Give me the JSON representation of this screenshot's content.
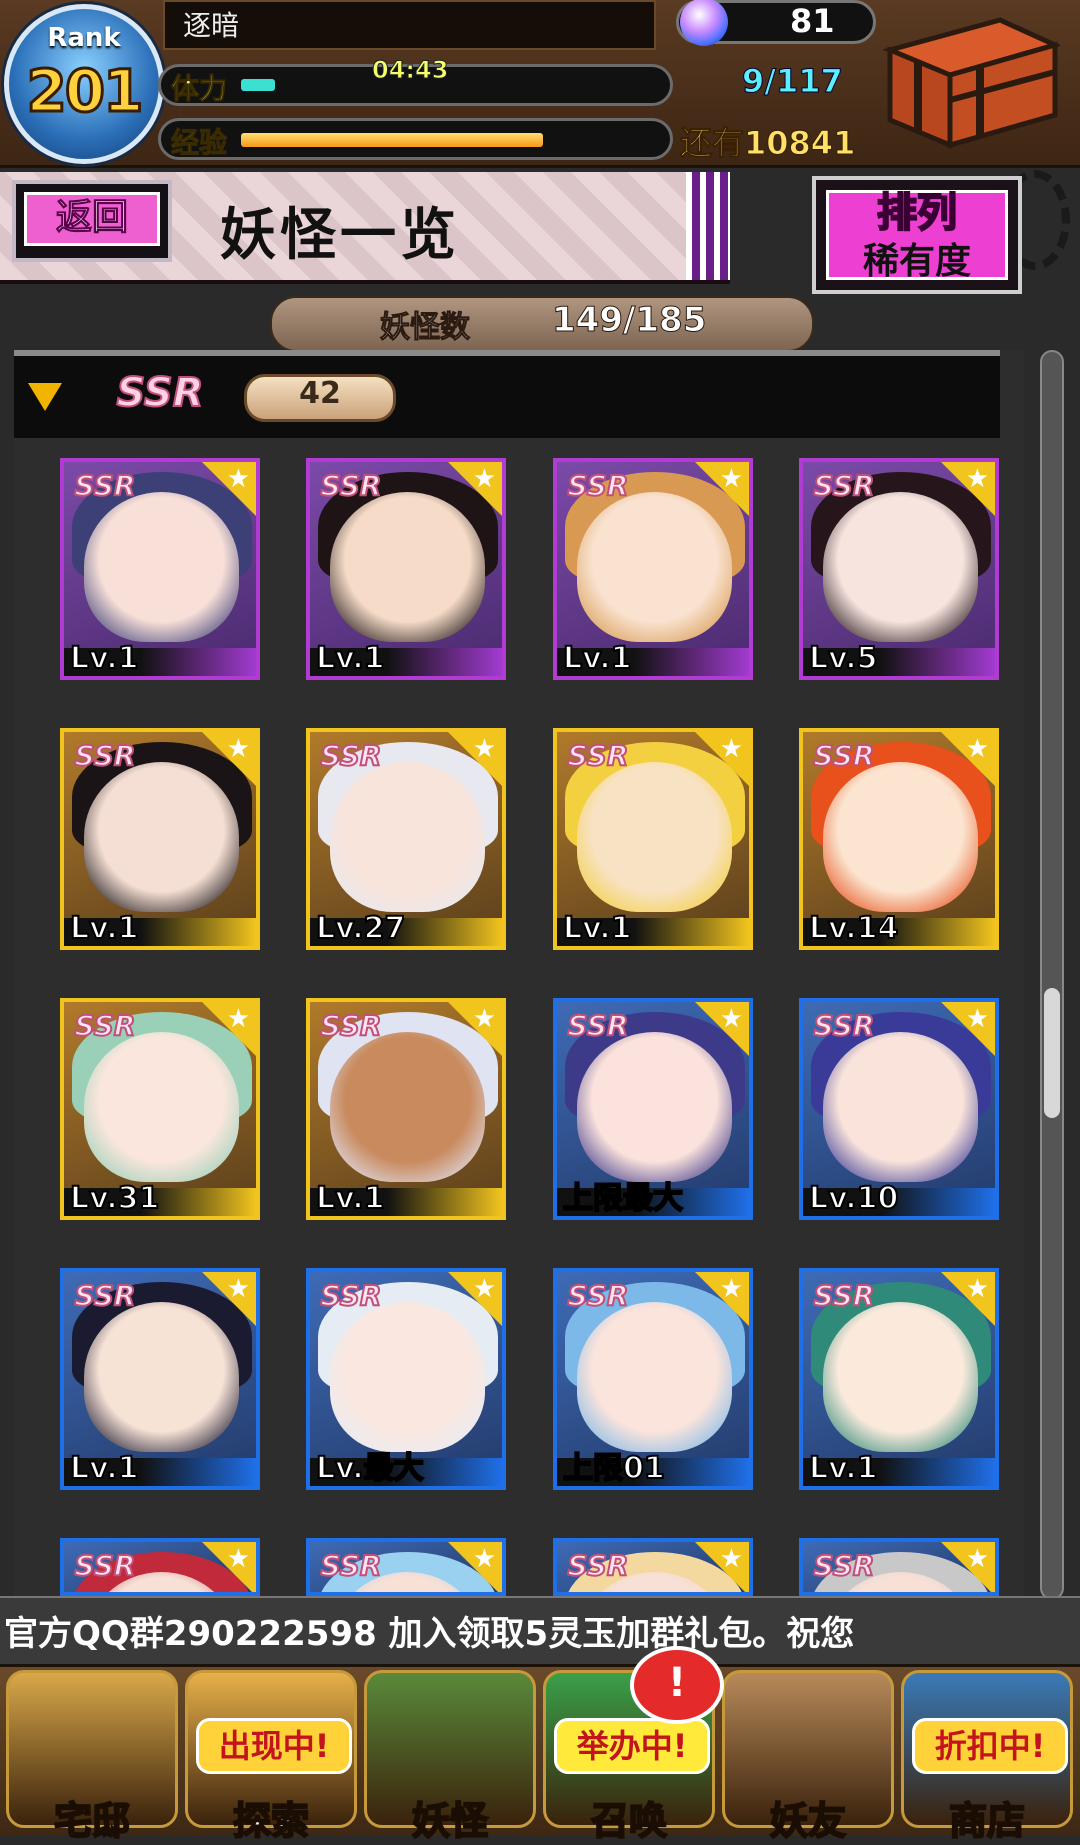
{
  "status": {
    "rank_label": "Rank",
    "rank_value": "201",
    "player_name": "逐暗",
    "stamina_label": "体力",
    "stamina_timer": "04:43",
    "stamina_fraction": 0.08,
    "exp_label": "经验",
    "exp_fraction": 0.72,
    "gem_count": "81",
    "slots": "9/117",
    "exp_remaining": "还有10841",
    "colors": {
      "stamina": "#3ce0d0",
      "exp": "#f5a21e",
      "gem": "#c98bff"
    }
  },
  "header": {
    "back_label": "返回",
    "title": "妖怪一览",
    "sort_line1": "排列",
    "sort_line2": "稀有度"
  },
  "summary": {
    "count_label": "妖怪数",
    "count_value": "149/185"
  },
  "group": {
    "rarity": "SSR",
    "count": "42"
  },
  "cards": [
    {
      "rarity": "SSR",
      "frame": "purple",
      "level": "Lv.1",
      "hair": "#3d3f77",
      "skin": "#f8e0d8"
    },
    {
      "rarity": "SSR",
      "frame": "purple",
      "level": "Lv.1",
      "hair": "#1e1416",
      "skin": "#f6dcc8"
    },
    {
      "rarity": "SSR",
      "frame": "purple",
      "level": "Lv.1",
      "hair": "#d89a52",
      "skin": "#f9e2cf"
    },
    {
      "rarity": "SSR",
      "frame": "purple",
      "level": "Lv.5",
      "hair": "#26161c",
      "skin": "#f7e4df"
    },
    {
      "rarity": "SSR",
      "frame": "gold",
      "level": "Lv.1",
      "hair": "#1a1416",
      "skin": "#f5dfd4"
    },
    {
      "rarity": "SSR",
      "frame": "gold",
      "level": "Lv.27",
      "hair": "#e8e8f0",
      "skin": "#f8e4da"
    },
    {
      "rarity": "SSR",
      "frame": "gold",
      "level": "Lv.1",
      "hair": "#f3d040",
      "skin": "#f8e2c4"
    },
    {
      "rarity": "SSR",
      "frame": "gold",
      "level": "Lv.14",
      "hair": "#e8501c",
      "skin": "#fbe5d0"
    },
    {
      "rarity": "SSR",
      "frame": "gold",
      "level": "Lv.31",
      "hair": "#9ad0b8",
      "skin": "#fae6dc"
    },
    {
      "rarity": "SSR",
      "frame": "gold",
      "level": "Lv.1",
      "hair": "#dfe3f2",
      "skin": "#c98a5e"
    },
    {
      "rarity": "SSR",
      "frame": "blue",
      "level": "上限最大",
      "hair": "#3d3a8a",
      "skin": "#fbe2dc"
    },
    {
      "rarity": "SSR",
      "frame": "blue",
      "level": "Lv.10",
      "hair": "#3a3a98",
      "skin": "#f9e3da"
    },
    {
      "rarity": "SSR",
      "frame": "blue",
      "level": "Lv.1",
      "hair": "#1a1a30",
      "skin": "#f7e2d6"
    },
    {
      "rarity": "SSR",
      "frame": "blue",
      "level": "Lv.最大",
      "hair": "#e6ecf4",
      "skin": "#fae8e0"
    },
    {
      "rarity": "SSR",
      "frame": "blue",
      "level": "上限01",
      "hair": "#7cb8e8",
      "skin": "#fbe4dc"
    },
    {
      "rarity": "SSR",
      "frame": "blue",
      "level": "Lv.1",
      "hair": "#2f8a7a",
      "skin": "#fbeadc"
    },
    {
      "rarity": "SSR",
      "frame": "blue",
      "level": "",
      "hair": "#c02a3a",
      "skin": "#f7e0d6"
    },
    {
      "rarity": "SSR",
      "frame": "blue",
      "level": "",
      "hair": "#9ad0f0",
      "skin": "#f7e0d6"
    },
    {
      "rarity": "SSR",
      "frame": "blue",
      "level": "",
      "hair": "#f3d9a0",
      "skin": "#f7e0d6"
    },
    {
      "rarity": "SSR",
      "frame": "blue",
      "level": "",
      "hair": "#c8c8c8",
      "skin": "#f7e0d6"
    }
  ],
  "ticker": "官方QQ群290222598   加入领取5灵玉加群礼包。祝您",
  "nav": [
    {
      "label": "宅邸",
      "badge": ""
    },
    {
      "label": "探索",
      "badge": "出现中!"
    },
    {
      "label": "妖怪",
      "badge": ""
    },
    {
      "label": "召唤",
      "badge": "举办中!"
    },
    {
      "label": "妖友",
      "badge": ""
    },
    {
      "label": "商店",
      "badge": "折扣中!"
    }
  ],
  "nav_alert": "!"
}
